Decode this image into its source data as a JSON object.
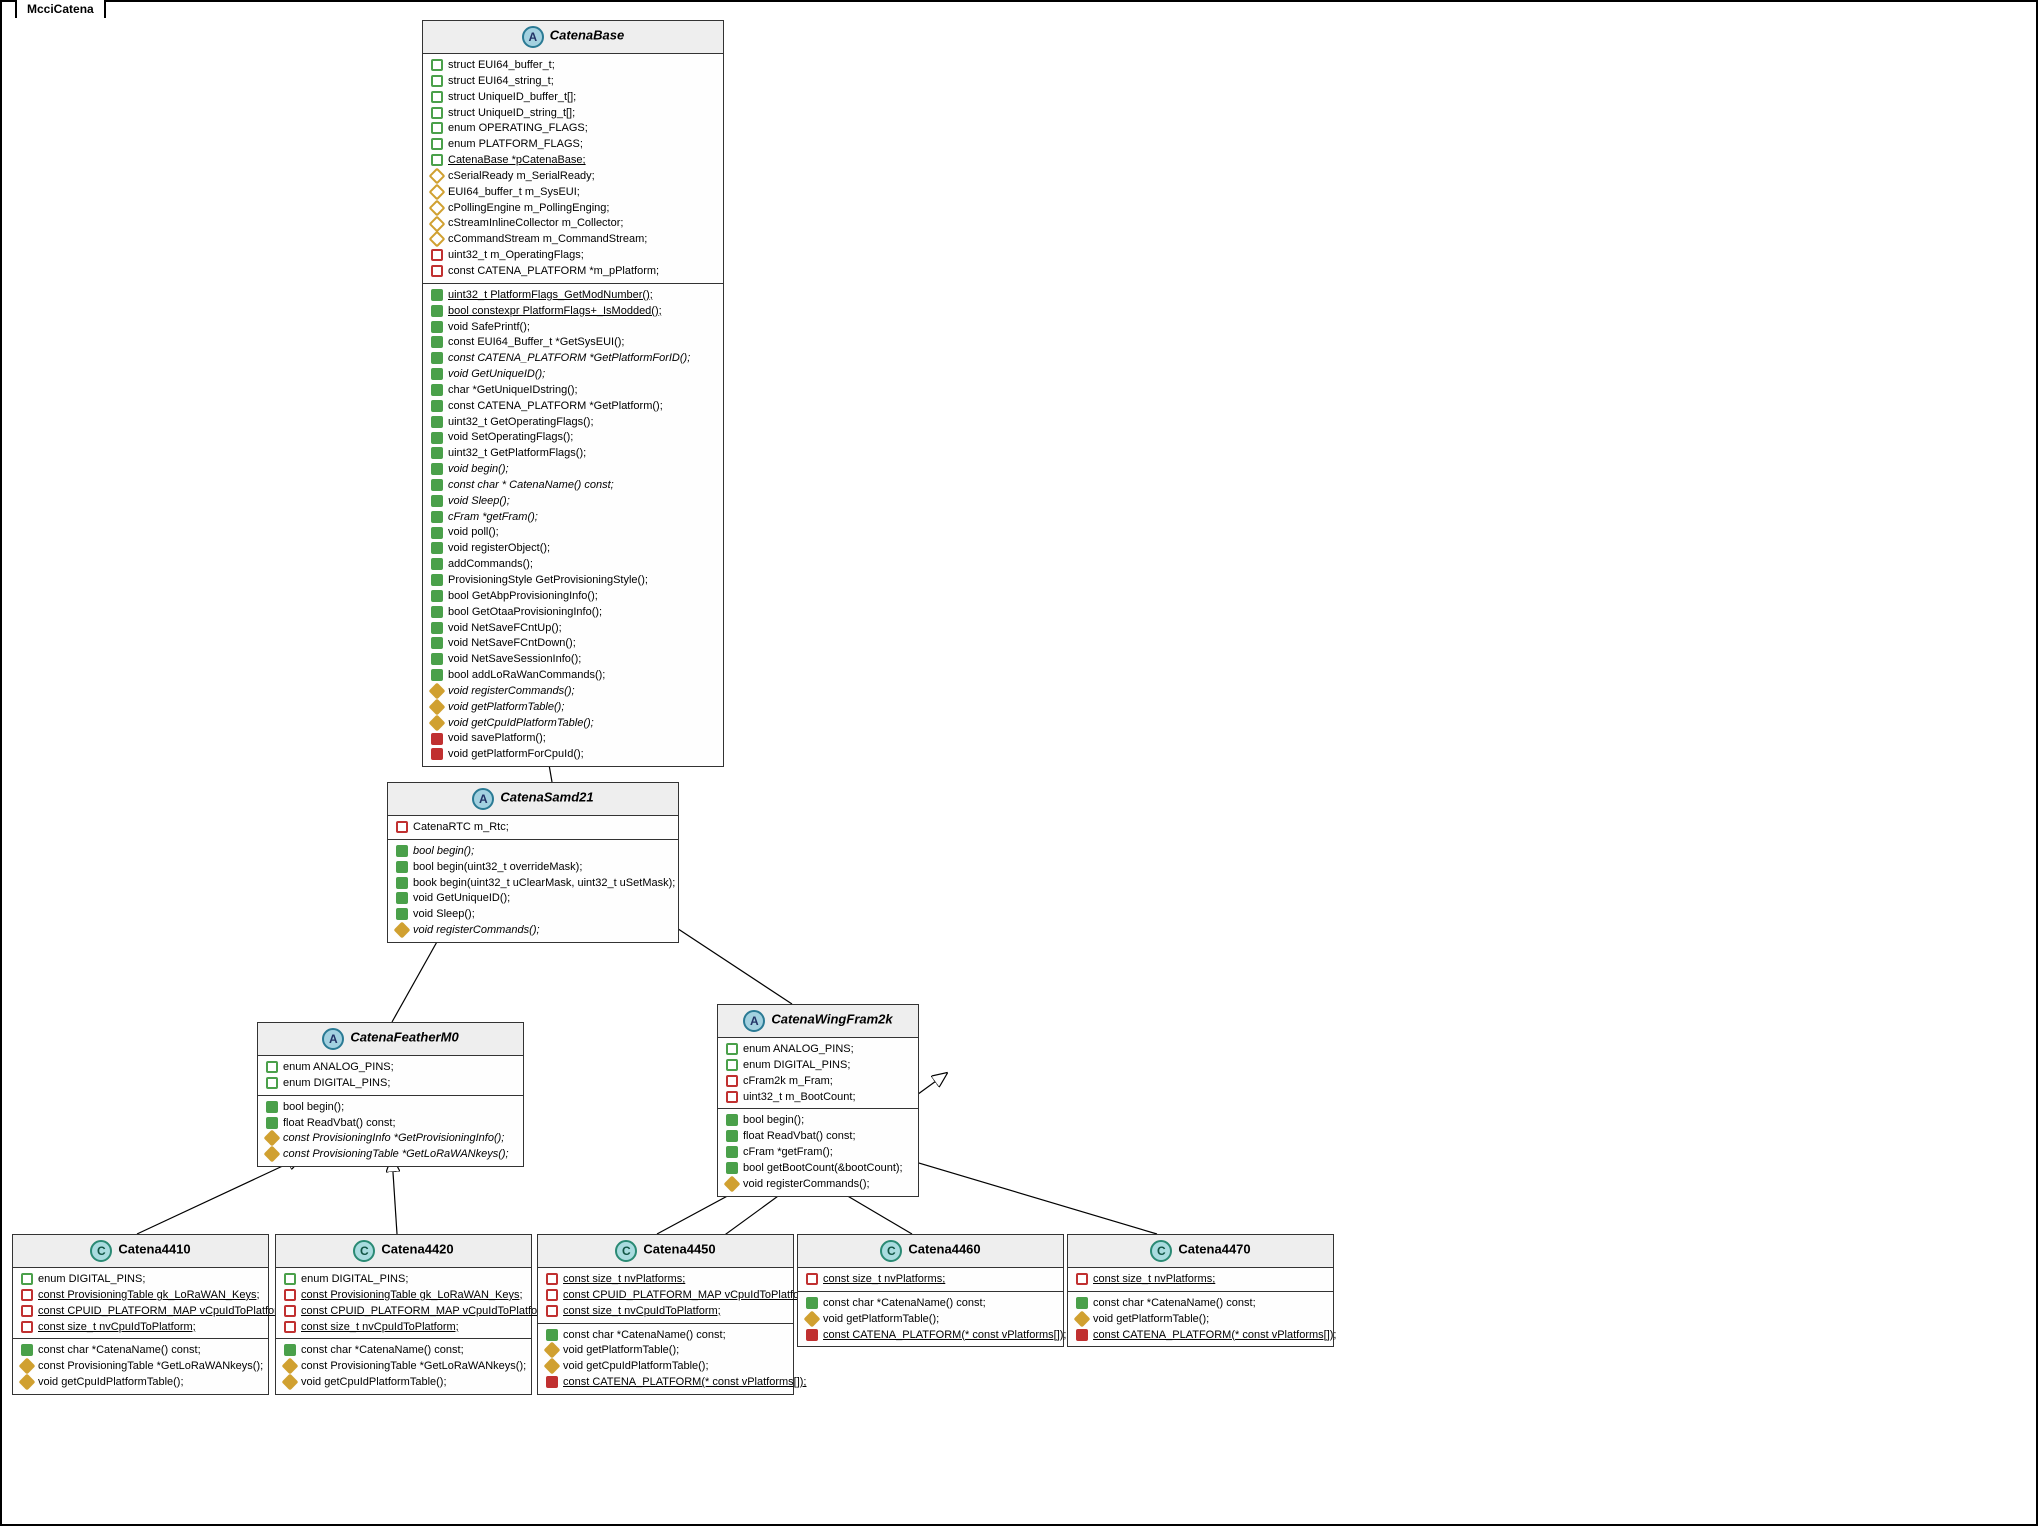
{
  "package": "McciCatena",
  "classes": {
    "CatenaBase": {
      "stereotype": "A",
      "nameItalic": true,
      "attrs": [
        {
          "vis": "pub-o",
          "txt": "struct EUI64_buffer_t;"
        },
        {
          "vis": "pub-o",
          "txt": "struct EUI64_string_t;"
        },
        {
          "vis": "pub-o",
          "txt": "struct UniqueID_buffer_t[];"
        },
        {
          "vis": "pub-o",
          "txt": "struct UniqueID_string_t[];"
        },
        {
          "vis": "pub-o",
          "txt": "enum OPERATING_FLAGS;"
        },
        {
          "vis": "pub-o",
          "txt": "enum PLATFORM_FLAGS;"
        },
        {
          "vis": "pub-o",
          "txt": "CatenaBase *pCatenaBase;",
          "static": true
        },
        {
          "vis": "prot-o",
          "txt": "cSerialReady   m_SerialReady;"
        },
        {
          "vis": "prot-o",
          "txt": "EUI64_buffer_t m_SysEUI;"
        },
        {
          "vis": "prot-o",
          "txt": "cPollingEngine m_PollingEnging;"
        },
        {
          "vis": "prot-o",
          "txt": "cStreamInlineCollector m_Collector;"
        },
        {
          "vis": "prot-o",
          "txt": "cCommandStream m_CommandStream;"
        },
        {
          "vis": "priv-o",
          "txt": "uint32_t m_OperatingFlags;"
        },
        {
          "vis": "priv-o",
          "txt": "const CATENA_PLATFORM *m_pPlatform;"
        }
      ],
      "ops": [
        {
          "vis": "pub-f",
          "txt": "uint32_t PlatformFlags_GetModNumber();",
          "static": true
        },
        {
          "vis": "pub-f",
          "txt": "bool constexpr PlatformFlags+_IsModded();",
          "static": true
        },
        {
          "vis": "pub-f",
          "txt": "void SafePrintf();"
        },
        {
          "vis": "pub-f",
          "txt": "const EUI64_Buffer_t *GetSysEUI();"
        },
        {
          "vis": "pub-f",
          "txt": "const CATENA_PLATFORM *GetPlatformForID();",
          "abstract": true
        },
        {
          "vis": "pub-f",
          "txt": "void GetUniqueID();",
          "abstract": true
        },
        {
          "vis": "pub-f",
          "txt": "char *GetUniqueIDstring();"
        },
        {
          "vis": "pub-f",
          "txt": "const CATENA_PLATFORM *GetPlatform();"
        },
        {
          "vis": "pub-f",
          "txt": "uint32_t GetOperatingFlags();"
        },
        {
          "vis": "pub-f",
          "txt": "void SetOperatingFlags();"
        },
        {
          "vis": "pub-f",
          "txt": "uint32_t GetPlatformFlags();"
        },
        {
          "vis": "pub-f",
          "txt": "void begin();",
          "abstract": true
        },
        {
          "vis": "pub-f",
          "txt": "const char * CatenaName() const;",
          "abstract": true
        },
        {
          "vis": "pub-f",
          "txt": "void Sleep();",
          "abstract": true
        },
        {
          "vis": "pub-f",
          "txt": "cFram *getFram();",
          "abstract": true
        },
        {
          "vis": "pub-f",
          "txt": "void poll();"
        },
        {
          "vis": "pub-f",
          "txt": "void registerObject();"
        },
        {
          "vis": "pub-f",
          "txt": "addCommands();"
        },
        {
          "vis": "pub-f",
          "txt": "ProvisioningStyle GetProvisioningStyle();"
        },
        {
          "vis": "pub-f",
          "txt": "bool GetAbpProvisioningInfo();"
        },
        {
          "vis": "pub-f",
          "txt": "bool GetOtaaProvisioningInfo();"
        },
        {
          "vis": "pub-f",
          "txt": "void NetSaveFCntUp();"
        },
        {
          "vis": "pub-f",
          "txt": "void NetSaveFCntDown();"
        },
        {
          "vis": "pub-f",
          "txt": "void NetSaveSessionInfo();"
        },
        {
          "vis": "pub-f",
          "txt": "bool addLoRaWanCommands();"
        },
        {
          "vis": "prot-f",
          "txt": "void registerCommands();",
          "abstract": true
        },
        {
          "vis": "prot-f",
          "txt": "void getPlatformTable();",
          "abstract": true
        },
        {
          "vis": "prot-f",
          "txt": "void getCpuIdPlatformTable();",
          "abstract": true
        },
        {
          "vis": "priv-f",
          "txt": "void savePlatform();"
        },
        {
          "vis": "priv-f",
          "txt": "void getPlatformForCpuId();"
        }
      ]
    },
    "CatenaSamd21": {
      "stereotype": "A",
      "nameItalic": true,
      "attrs": [
        {
          "vis": "priv-o",
          "txt": "CatenaRTC m_Rtc;"
        }
      ],
      "ops": [
        {
          "vis": "pub-f",
          "txt": "bool begin();",
          "abstract": true
        },
        {
          "vis": "pub-f",
          "txt": "bool begin(uint32_t overrideMask);"
        },
        {
          "vis": "pub-f",
          "txt": "book begin(uint32_t uClearMask, uint32_t uSetMask);"
        },
        {
          "vis": "pub-f",
          "txt": "void GetUniqueID();"
        },
        {
          "vis": "pub-f",
          "txt": "void Sleep();"
        },
        {
          "vis": "prot-f",
          "txt": "void registerCommands();",
          "abstract": true
        }
      ]
    },
    "CatenaFeatherM0": {
      "stereotype": "A",
      "nameItalic": true,
      "attrs": [
        {
          "vis": "pub-o",
          "txt": "enum ANALOG_PINS;"
        },
        {
          "vis": "pub-o",
          "txt": "enum DIGITAL_PINS;"
        }
      ],
      "ops": [
        {
          "vis": "pub-f",
          "txt": "bool begin();"
        },
        {
          "vis": "pub-f",
          "txt": "float ReadVbat() const;"
        },
        {
          "vis": "prot-f",
          "txt": "const ProvisioningInfo *GetProvisioningInfo();",
          "abstract": true
        },
        {
          "vis": "prot-f",
          "txt": "const ProvisioningTable *GetLoRaWANkeys();",
          "abstract": true
        }
      ]
    },
    "CatenaWingFram2k": {
      "stereotype": "A",
      "nameItalic": true,
      "attrs": [
        {
          "vis": "pub-o",
          "txt": "enum ANALOG_PINS;"
        },
        {
          "vis": "pub-o",
          "txt": "enum DIGITAL_PINS;"
        },
        {
          "vis": "priv-o",
          "txt": "cFram2k  m_Fram;"
        },
        {
          "vis": "priv-o",
          "txt": "uint32_t m_BootCount;"
        }
      ],
      "ops": [
        {
          "vis": "pub-f",
          "txt": "bool begin();"
        },
        {
          "vis": "pub-f",
          "txt": "float ReadVbat() const;"
        },
        {
          "vis": "pub-f",
          "txt": "cFram *getFram();"
        },
        {
          "vis": "pub-f",
          "txt": "bool getBootCount(&bootCount);"
        },
        {
          "vis": "prot-f",
          "txt": "void registerCommands();"
        }
      ]
    },
    "Catena4410": {
      "stereotype": "C",
      "nameItalic": false,
      "attrs": [
        {
          "vis": "pub-o",
          "txt": "enum DIGITAL_PINS;"
        },
        {
          "vis": "priv-o",
          "txt": "const ProvisioningTable gk_LoRaWAN_Keys;",
          "static": true
        },
        {
          "vis": "priv-o",
          "txt": "const CPUID_PLATFORM_MAP vCpuIdToPlatform[];",
          "static": true
        },
        {
          "vis": "priv-o",
          "txt": "const size_t nvCpuIdToPlatform;",
          "static": true
        }
      ],
      "ops": [
        {
          "vis": "pub-f",
          "txt": "const char *CatenaName() const;"
        },
        {
          "vis": "prot-f",
          "txt": "const ProvisioningTable *GetLoRaWANkeys();"
        },
        {
          "vis": "prot-f",
          "txt": "void getCpuIdPlatformTable();"
        }
      ]
    },
    "Catena4420": {
      "stereotype": "C",
      "nameItalic": false,
      "attrs": [
        {
          "vis": "pub-o",
          "txt": "enum DIGITAL_PINS;"
        },
        {
          "vis": "priv-o",
          "txt": "const ProvisioningTable gk_LoRaWAN_Keys;",
          "static": true
        },
        {
          "vis": "priv-o",
          "txt": "const CPUID_PLATFORM_MAP vCpuIdToPlatform[];",
          "static": true
        },
        {
          "vis": "priv-o",
          "txt": "const size_t nvCpuIdToPlatform;",
          "static": true
        }
      ],
      "ops": [
        {
          "vis": "pub-f",
          "txt": "const char *CatenaName() const;"
        },
        {
          "vis": "prot-f",
          "txt": "const ProvisioningTable *GetLoRaWANkeys();"
        },
        {
          "vis": "prot-f",
          "txt": "void getCpuIdPlatformTable();"
        }
      ]
    },
    "Catena4450": {
      "stereotype": "C",
      "nameItalic": false,
      "attrs": [
        {
          "vis": "priv-o",
          "txt": "const size_t nvPlatforms;",
          "static": true
        },
        {
          "vis": "priv-o",
          "txt": "const CPUID_PLATFORM_MAP vCpuIdToPlatform[];",
          "static": true
        },
        {
          "vis": "priv-o",
          "txt": "const size_t nvCpuIdToPlatform;",
          "static": true
        }
      ],
      "ops": [
        {
          "vis": "pub-f",
          "txt": "const char *CatenaName() const;"
        },
        {
          "vis": "prot-f",
          "txt": "void getPlatformTable();"
        },
        {
          "vis": "prot-f",
          "txt": "void getCpuIdPlatformTable();"
        },
        {
          "vis": "priv-f",
          "txt": "const CATENA_PLATFORM(* const vPlatforms[]);",
          "static": true
        }
      ]
    },
    "Catena4460": {
      "stereotype": "C",
      "nameItalic": false,
      "attrs": [
        {
          "vis": "priv-o",
          "txt": "const size_t nvPlatforms;",
          "static": true
        }
      ],
      "ops": [
        {
          "vis": "pub-f",
          "txt": "const char *CatenaName() const;"
        },
        {
          "vis": "prot-f",
          "txt": "void getPlatformTable();"
        },
        {
          "vis": "priv-f",
          "txt": "const CATENA_PLATFORM(* const vPlatforms[]);",
          "static": true
        }
      ]
    },
    "Catena4470": {
      "stereotype": "C",
      "nameItalic": false,
      "attrs": [
        {
          "vis": "priv-o",
          "txt": "const size_t nvPlatforms;",
          "static": true
        }
      ],
      "ops": [
        {
          "vis": "pub-f",
          "txt": "const char *CatenaName() const;"
        },
        {
          "vis": "prot-f",
          "txt": "void getPlatformTable();"
        },
        {
          "vis": "priv-f",
          "txt": "const CATENA_PLATFORM(* const vPlatforms[]);",
          "static": true
        }
      ]
    }
  }
}
